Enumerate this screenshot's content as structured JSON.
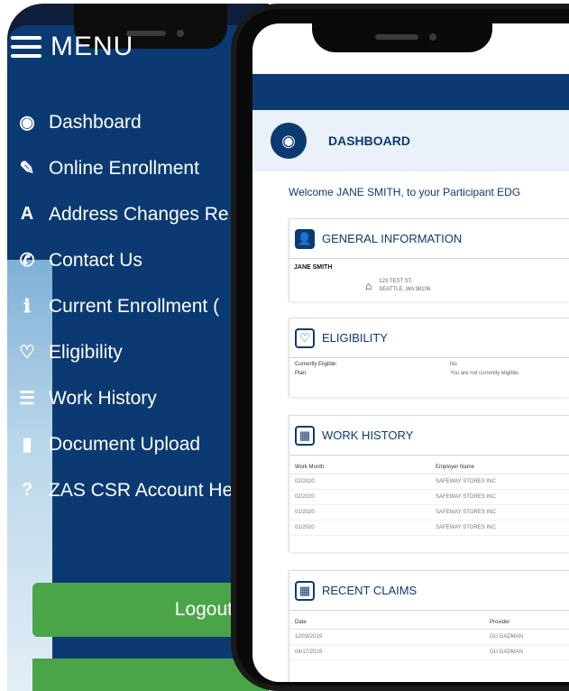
{
  "menu": {
    "title": "MENU",
    "items": [
      {
        "icon": "dashboard-icon",
        "glyph": "◉",
        "label": "Dashboard"
      },
      {
        "icon": "pencil-icon",
        "glyph": "✎",
        "label": "Online Enrollment"
      },
      {
        "icon": "road-icon",
        "glyph": "A",
        "label": "Address Changes Re"
      },
      {
        "icon": "phone-icon",
        "glyph": "✆",
        "label": "Contact Us"
      },
      {
        "icon": "info-icon",
        "glyph": "ℹ",
        "label": "Current Enrollment ("
      },
      {
        "icon": "heart-icon",
        "glyph": "♡",
        "label": "Eligibility"
      },
      {
        "icon": "table-icon",
        "glyph": "☰",
        "label": "Work History"
      },
      {
        "icon": "file-icon",
        "glyph": "▮",
        "label": "Document Upload"
      },
      {
        "icon": "question-icon",
        "glyph": "?",
        "label": "ZAS CSR Account He"
      }
    ],
    "logout_label": "Logout"
  },
  "dashboard": {
    "title": "DASHBOARD",
    "welcome": "Welcome JANE SMITH, to your Participant EDG",
    "general_info": {
      "title": "GENERAL INFORMATION",
      "name": "JANE SMITH",
      "address_line1": "123 TEST ST.",
      "address_line2": "SEATTLE, WA 98106"
    },
    "eligibility": {
      "title": "ELIGIBILITY",
      "rows": [
        {
          "k": "Currently Eligible:",
          "v": "No"
        },
        {
          "k": "Plan:",
          "v": "You are not currently eligible."
        }
      ]
    },
    "work_history": {
      "title": "WORK HISTORY",
      "headers": [
        "Work Month",
        "Employer Name"
      ],
      "rows": [
        [
          "02/2020",
          "SAFEWAY STORES INC"
        ],
        [
          "02/2020",
          "SAFEWAY STORES INC"
        ],
        [
          "01/2020",
          "SAFEWAY STORES INC"
        ],
        [
          "01/2020",
          "SAFEWAY STORES INC"
        ]
      ]
    },
    "recent_claims": {
      "title": "RECENT CLAIMS",
      "headers": [
        "Date",
        "Provider"
      ],
      "rows": [
        [
          "12/03/2019",
          "GU GADMAN"
        ],
        [
          "04/17/2019",
          "GU GADMAN"
        ]
      ]
    }
  },
  "colors": {
    "navy": "#0b3a72",
    "logout_green": "#4aa548"
  }
}
